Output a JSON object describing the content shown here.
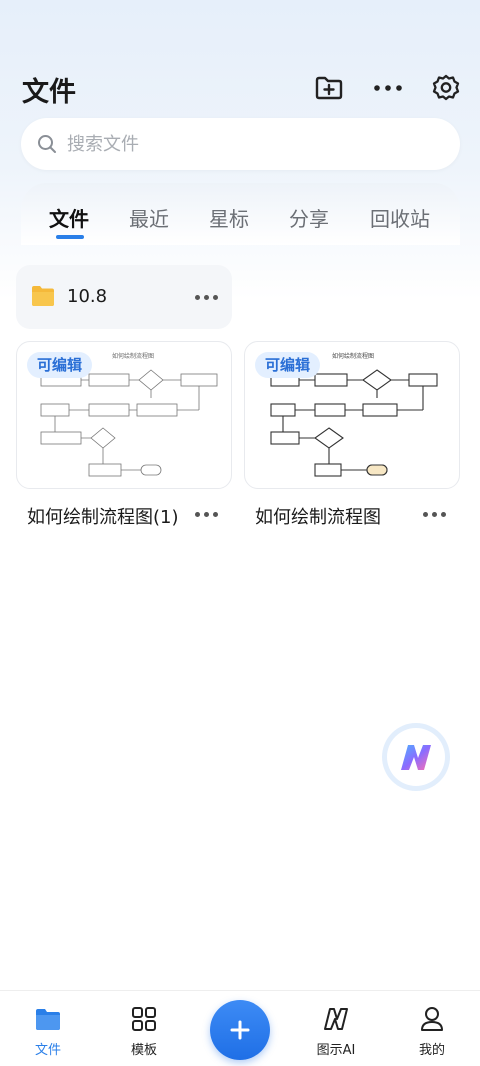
{
  "header": {
    "title": "文件",
    "icons": [
      "add-folder-icon",
      "more-icon",
      "settings-icon"
    ]
  },
  "search": {
    "placeholder": "搜索文件",
    "value": ""
  },
  "tabs": [
    {
      "label": "文件",
      "active": true
    },
    {
      "label": "最近",
      "active": false
    },
    {
      "label": "星标",
      "active": false
    },
    {
      "label": "分享",
      "active": false
    },
    {
      "label": "回收站",
      "active": false
    }
  ],
  "folders": [
    {
      "name": "10.8"
    }
  ],
  "files": [
    {
      "name": "如何绘制流程图(1)",
      "badge": "可编辑",
      "thumbnail_title": "如何绘制流程图"
    },
    {
      "name": "如何绘制流程图",
      "badge": "可编辑",
      "thumbnail_title": "如何绘制流程图"
    }
  ],
  "bottom_nav": [
    {
      "label": "文件",
      "icon": "folder-icon",
      "active": true
    },
    {
      "label": "模板",
      "icon": "grid-icon",
      "active": false
    },
    {
      "label": "",
      "icon": "plus-icon",
      "active": false
    },
    {
      "label": "图示AI",
      "icon": "ai-logo-icon",
      "active": false
    },
    {
      "label": "我的",
      "icon": "profile-icon",
      "active": false
    }
  ],
  "colors": {
    "accent": "#2a7fe8",
    "folder": "#f5b93a",
    "badge_bg": "#e3efff",
    "badge_text": "#2a6fd6"
  }
}
